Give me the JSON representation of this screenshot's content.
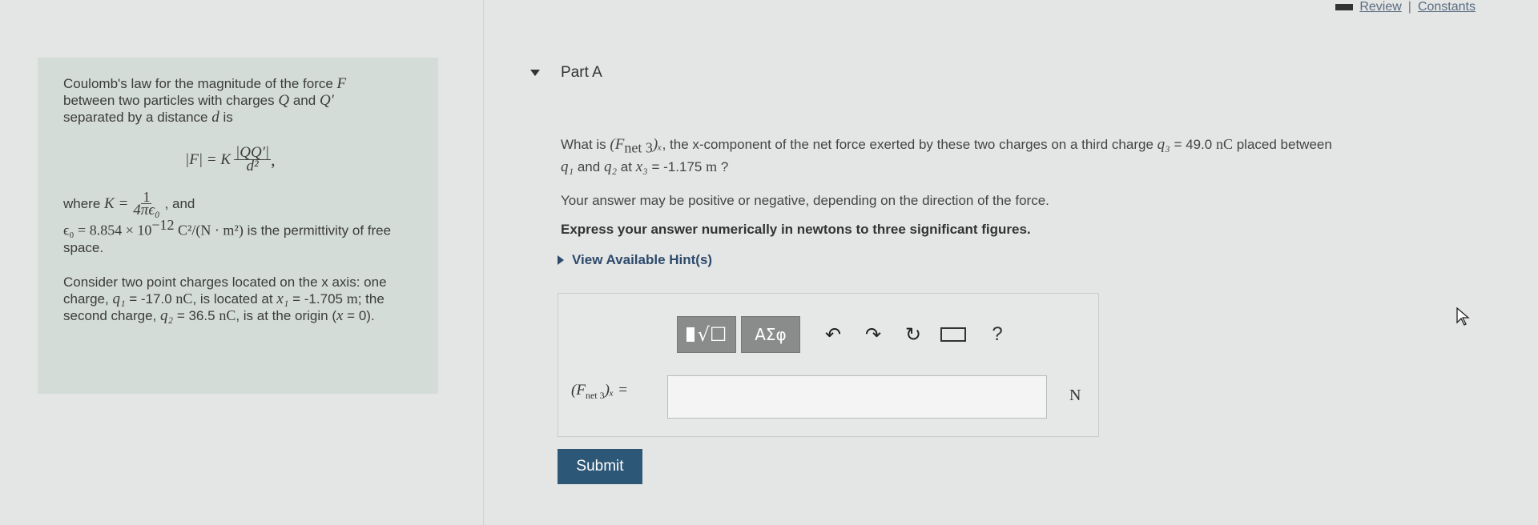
{
  "topbar": {
    "review": "Review",
    "separator": "|",
    "constants": "Constants"
  },
  "intro": {
    "line1": "Coulomb's law for the magnitude of the force",
    "F": "F",
    "line2a": "between two particles with charges",
    "Q": "Q",
    "and": "and",
    "Qp": "Q′",
    "line3": "separated by a distance",
    "d": "d",
    "is": "is",
    "formula_lhs": "|F| = K",
    "formula_num": "|QQ′|",
    "formula_den": "d²",
    "where": "where",
    "K_eq": "K =",
    "K_num": "1",
    "K_den": "4πϵ₀",
    "and2": ", and",
    "eps_eq": "ϵ₀ = 8.854 × 10",
    "eps_exp": "−12",
    "eps_units": " C²/(N · m²)",
    "eps_text": "is the permittivity of free space."
  },
  "scenario": {
    "text1": "Consider two point charges located on the x axis: one charge,",
    "q1": "q₁",
    "q1_value": "= -17.0",
    "nC": "nC",
    "text2": ", is located at",
    "x1": "x₁",
    "x1_value": "= -1.705",
    "m": "m",
    "text3": "; the second charge,",
    "q2": "q₂",
    "q2_value": "= 36.5",
    "text4": ", is at the origin (",
    "x": "x",
    "text5": "= 0)."
  },
  "part": {
    "label": "Part A"
  },
  "question": {
    "what_is": "What is",
    "fnet": "(F",
    "fnet_sub": "net 3",
    "fnet_close": ")ₓ",
    "text1": ", the x-component of the net force exerted by these two charges on a third charge",
    "q3": "q₃",
    "q3_value": "= 49.0",
    "nC": "nC",
    "text2": "placed between",
    "q1": "q₁",
    "and": "and",
    "q2": "q₂",
    "at": "at",
    "x3": "x₃",
    "x3_value": "= -1.175",
    "m": "m",
    "qmark": "?",
    "line2": "Your answer may be positive or negative, depending on the direction of the force.",
    "line3": "Express your answer numerically in newtons to three significant figures.",
    "hint_link": "View Available Hint(s)"
  },
  "toolbar": {
    "greek": "ΑΣφ",
    "undo": "↶",
    "redo": "↷",
    "reset": "↻",
    "help": "?"
  },
  "answer": {
    "label": "(F",
    "label_sub": "net 3",
    "label_close": ")ₓ =",
    "value": "",
    "unit": "N"
  },
  "submit": {
    "label": "Submit"
  }
}
